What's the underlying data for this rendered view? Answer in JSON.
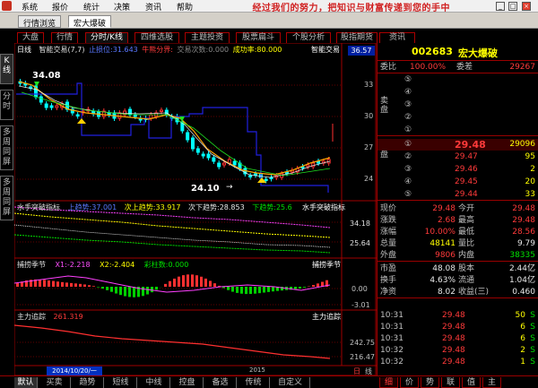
{
  "menu": {
    "items": [
      "系统",
      "报价",
      "统计",
      "决策",
      "资讯",
      "帮助"
    ],
    "slogan": "经过我们的努力，把知识与财富传递到您的手中",
    "min": "_",
    "restore": "□",
    "close": "×"
  },
  "tabs": [
    {
      "label": "行情浏览"
    },
    {
      "label": "宏大爆破",
      "active": true
    }
  ],
  "subtabs": [
    {
      "label": "大盘"
    },
    {
      "label": "行情"
    },
    {
      "label": "分时/K线",
      "active": true
    },
    {
      "label": "四维选股"
    },
    {
      "label": "主题投资"
    },
    {
      "label": "股票扁斗"
    },
    {
      "label": "个股分析"
    },
    {
      "label": "股指期货"
    },
    {
      "label": "资讯"
    }
  ],
  "left_tabs": [
    {
      "label": "K线",
      "active": true
    },
    {
      "label": "分时"
    },
    {
      "label": "多周同屏"
    },
    {
      "label": "多周同屏"
    }
  ],
  "kline": {
    "header_left": "日线",
    "header_indicator": "智能交易(7,7)",
    "header_vals": [
      {
        "t": "止损位:31.643",
        "c": "blue"
      },
      {
        "t": "牛熊分界:",
        "c": "red"
      },
      {
        "t": "交易次数:0.000",
        "c": "gray"
      },
      {
        "t": "成功率:80.000",
        "c": "yellow"
      },
      {
        "t": "智能交易",
        "c": "white"
      }
    ],
    "price_box": "36.57",
    "yaxis": [
      "33",
      "30",
      "27",
      "24"
    ],
    "annot_high": "34.08",
    "annot_low": "24.10"
  },
  "macd": {
    "title": "水手突破指标",
    "vals": [
      {
        "t": "上趋势:37.001",
        "c": "blue"
      },
      {
        "t": "次上趋势:33.917",
        "c": "yellow"
      },
      {
        "t": "次下趋势:28.853",
        "c": "white"
      },
      {
        "t": "下趋势:25.6",
        "c": "green"
      }
    ],
    "right_label": "水手突破指标",
    "yaxis": [
      "34.18",
      "25.64"
    ]
  },
  "season": {
    "title": "捕捞季节",
    "vals": [
      {
        "t": "X1:-2.218",
        "c": "magenta"
      },
      {
        "t": "X2:-2.404",
        "c": "yellow"
      },
      {
        "t": "彩柱数:0.000",
        "c": "green"
      }
    ],
    "right_label": "捕捞季节",
    "yaxis": [
      "0.00",
      "-3.01"
    ]
  },
  "mainforce": {
    "title": "主力追踪",
    "val": "261.319",
    "right_label": "主力追踪",
    "yaxis": [
      "242.75",
      "216.47"
    ]
  },
  "xaxis": {
    "date_box": "2014/10/20/一",
    "tick": "2015",
    "tag": "日",
    "tag2": "线"
  },
  "quote": {
    "code": "002683",
    "name": "宏大爆破",
    "weibi_label": "委比",
    "weibi_val": "100.00%",
    "weicha_label": "委差",
    "weicha_val": "29267",
    "sell_label": "卖盘",
    "buy_label": "买盘",
    "sell_nums": [
      "⑤",
      "④",
      "③",
      "②",
      "①"
    ],
    "buys": [
      {
        "n": "①",
        "p": "29.48",
        "v": "29096"
      },
      {
        "n": "②",
        "p": "29.47",
        "v": "95"
      },
      {
        "n": "③",
        "p": "29.46",
        "v": "2"
      },
      {
        "n": "④",
        "p": "29.45",
        "v": "20"
      },
      {
        "n": "⑤",
        "p": "29.44",
        "v": "33"
      }
    ],
    "stats": [
      {
        "l1": "现价",
        "v1": "29.48",
        "c1": "red",
        "l2": "今开",
        "v2": "29.48",
        "c2": "red"
      },
      {
        "l1": "涨跌",
        "v1": "2.68",
        "c1": "red",
        "l2": "最高",
        "v2": "29.48",
        "c2": "red"
      },
      {
        "l1": "涨幅",
        "v1": "10.00%",
        "c1": "red",
        "l2": "最低",
        "v2": "28.56",
        "c2": "red"
      },
      {
        "l1": "总量",
        "v1": "48141",
        "c1": "yellow",
        "l2": "量比",
        "v2": "9.79",
        "c2": "white"
      },
      {
        "l1": "外盘",
        "v1": "9806",
        "c1": "red",
        "l2": "内盘",
        "v2": "38335",
        "c2": "green"
      },
      {
        "l1": "市盈",
        "v1": "48.08",
        "c1": "white",
        "l2": "股本",
        "v2": "2.44亿",
        "c2": "white"
      },
      {
        "l1": "换手",
        "v1": "4.63%",
        "c1": "white",
        "l2": "流通",
        "v2": "1.04亿",
        "c2": "white"
      },
      {
        "l1": "净资",
        "v1": "8.02",
        "c1": "white",
        "l2": "收益(三)",
        "v2": "0.460",
        "c2": "white"
      }
    ],
    "ticks": [
      {
        "t": "10:31",
        "p": "29.48",
        "v": "50",
        "s": "S"
      },
      {
        "t": "10:31",
        "p": "29.48",
        "v": "6",
        "s": "S"
      },
      {
        "t": "10:31",
        "p": "29.48",
        "v": "6",
        "s": "S"
      },
      {
        "t": "10:32",
        "p": "29.48",
        "v": "2",
        "s": "S"
      },
      {
        "t": "10:32",
        "p": "29.48",
        "v": "1",
        "s": "S"
      }
    ]
  },
  "bottom_tabs": [
    "默认",
    "买卖",
    "趋势",
    "短线",
    "中线",
    "控盘",
    "备选",
    "传统",
    "自定义"
  ],
  "right_bottom_tabs": [
    "细",
    "价",
    "势",
    "联",
    "值",
    "主"
  ]
}
